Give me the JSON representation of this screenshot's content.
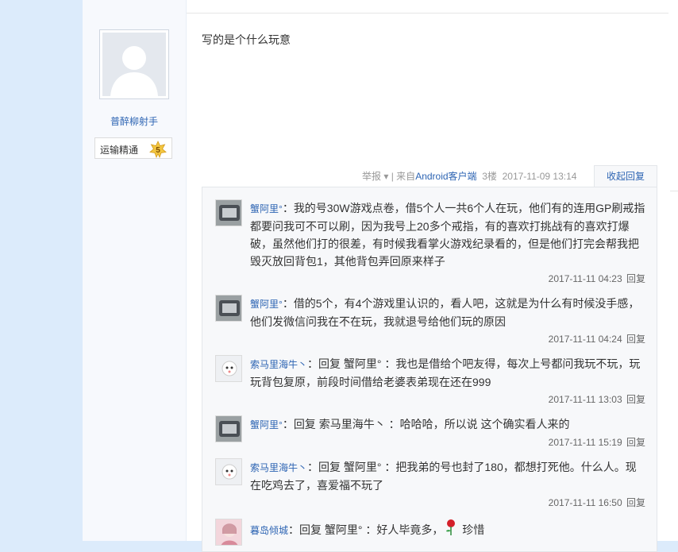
{
  "post": {
    "author": "普醉柳射手",
    "badge_label": "运输精通",
    "badge_level": "5",
    "content": "写的是个什么玩意",
    "meta": {
      "report": "举报",
      "source": "| 来自",
      "client": "Android客户端",
      "floor": "3楼",
      "time": "2017-11-09 13:14",
      "collapse": "收起回复"
    }
  },
  "replies": [
    {
      "user": "蟹阿里°",
      "sep": "：",
      "text": "我的号30W游戏点卷，借5个人一共6个人在玩，他们有的连用GP刷戒指都要问我可不可以刷，因为我号上20多个戒指，有的喜欢打挑战有的喜欢打爆破，虽然他们打的很差，有时候我看掌火游戏纪录看的，但是他们打完会帮我把毁灭放回背包1，其他背包弄回原来样子",
      "time": "2017-11-11 04:23",
      "reply": "回复"
    },
    {
      "user": "蟹阿里°",
      "sep": "：",
      "text": "借的5个，有4个游戏里认识的，看人吧，这就是为什么有时候没手感，他们发微信问我在不在玩，我就退号给他们玩的原因",
      "time": "2017-11-11 04:24",
      "reply": "回复"
    },
    {
      "user": "索马里海牛丶",
      "sep": "：",
      "text": "回复 蟹阿里° ：我也是借给个吧友得，每次上号都问我玩不玩，玩玩背包复原，前段时间借给老婆表弟现在还在999",
      "time": "2017-11-11 13:03",
      "reply": "回复"
    },
    {
      "user": "蟹阿里°",
      "sep": "：",
      "text": "回复 索马里海牛丶 ：哈哈哈，所以说 这个确实看人来的",
      "time": "2017-11-11 15:19",
      "reply": "回复"
    },
    {
      "user": "索马里海牛丶",
      "sep": "：",
      "text": "回复 蟹阿里° ：把我弟的号也封了180，都想打死他。什么人。现在吃鸡去了，喜爱福不玩了",
      "time": "2017-11-11 16:50",
      "reply": "回复"
    },
    {
      "user": "暮岛倾城",
      "sep": "：",
      "text": "回复 蟹阿里° ：好人毕竟多，",
      "text_after": "珍惜",
      "time": "",
      "reply": ""
    }
  ],
  "icons": {
    "dropdown": "chevron-down-icon",
    "rose": "rose-icon"
  },
  "colors": {
    "link": "#2d64b3",
    "background": "#dcebfb"
  }
}
